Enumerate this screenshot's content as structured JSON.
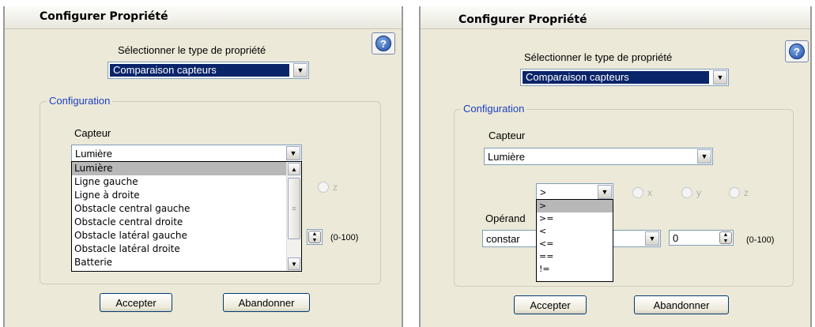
{
  "left": {
    "title": "Configurer Propriété",
    "prompt": "Sélectionner le type de propriété",
    "type_value": "Comparaison capteurs",
    "group_label": "Configuration",
    "capteur_label": "Capteur",
    "capteur_value": "Lumière",
    "capteur_options": [
      "Lumière",
      "Ligne gauche",
      "Ligne à droite",
      "Obstacle central gauche",
      "Obstacle central droite",
      "Obstacle latéral gauche",
      "Obstacle latéral droite",
      "Batterie"
    ],
    "highlighted_option": "Lumière",
    "radio_z": "z",
    "range": "(0-100)",
    "accept_label": "Accepter",
    "cancel_label": "Abandonner"
  },
  "right": {
    "title": "Configurer Propriété",
    "prompt": "Sélectionner le type de propriété",
    "type_value": "Comparaison capteurs",
    "group_label": "Configuration",
    "capteur_label": "Capteur",
    "capteur_value": "Lumière",
    "operator_value": ">",
    "operator_options": [
      ">",
      ">=",
      "<",
      "<=",
      "==",
      "!="
    ],
    "highlighted_option": ">",
    "radio_x": "x",
    "radio_y": "y",
    "radio_z": "z",
    "operand_label_partial": "Opérand",
    "operand_value_partial": "constar",
    "number_value": "0",
    "range": "(0-100)",
    "accept_label": "Accepter",
    "cancel_label": "Abandonner"
  }
}
